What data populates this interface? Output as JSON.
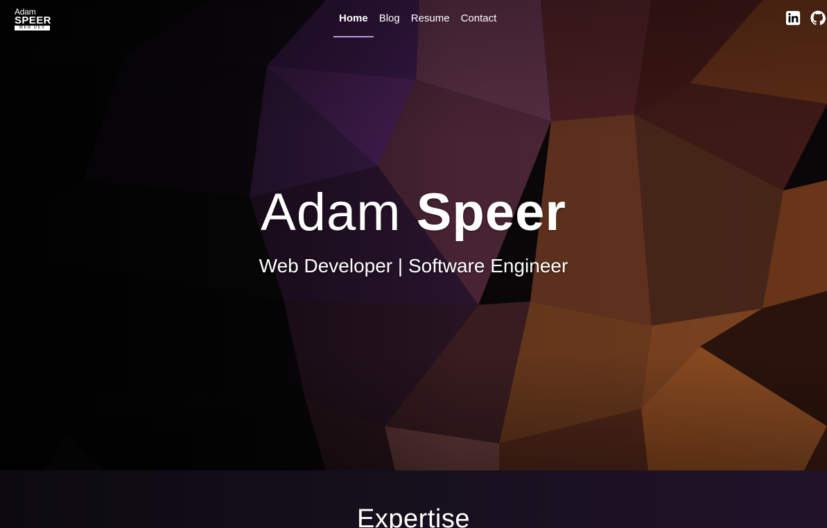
{
  "logo": {
    "line1": "Adam",
    "line2": "SPEER",
    "line3": "WEB DEV"
  },
  "nav": {
    "items": [
      {
        "label": "Home"
      },
      {
        "label": "Blog"
      },
      {
        "label": "Resume"
      },
      {
        "label": "Contact"
      }
    ],
    "active": "Home"
  },
  "social": {
    "icons": [
      "linkedin-icon",
      "github-icon"
    ]
  },
  "hero": {
    "first_name": "Adam",
    "last_name": "Speer",
    "subtitle": "Web Developer | Software Engineer"
  },
  "section": {
    "heading": "Expertise"
  },
  "colors": {
    "nav_active_underline": "#b39ddb",
    "purple": "#5a2a6e",
    "copper": "#8a4a24",
    "section_bg": "#16101d"
  }
}
